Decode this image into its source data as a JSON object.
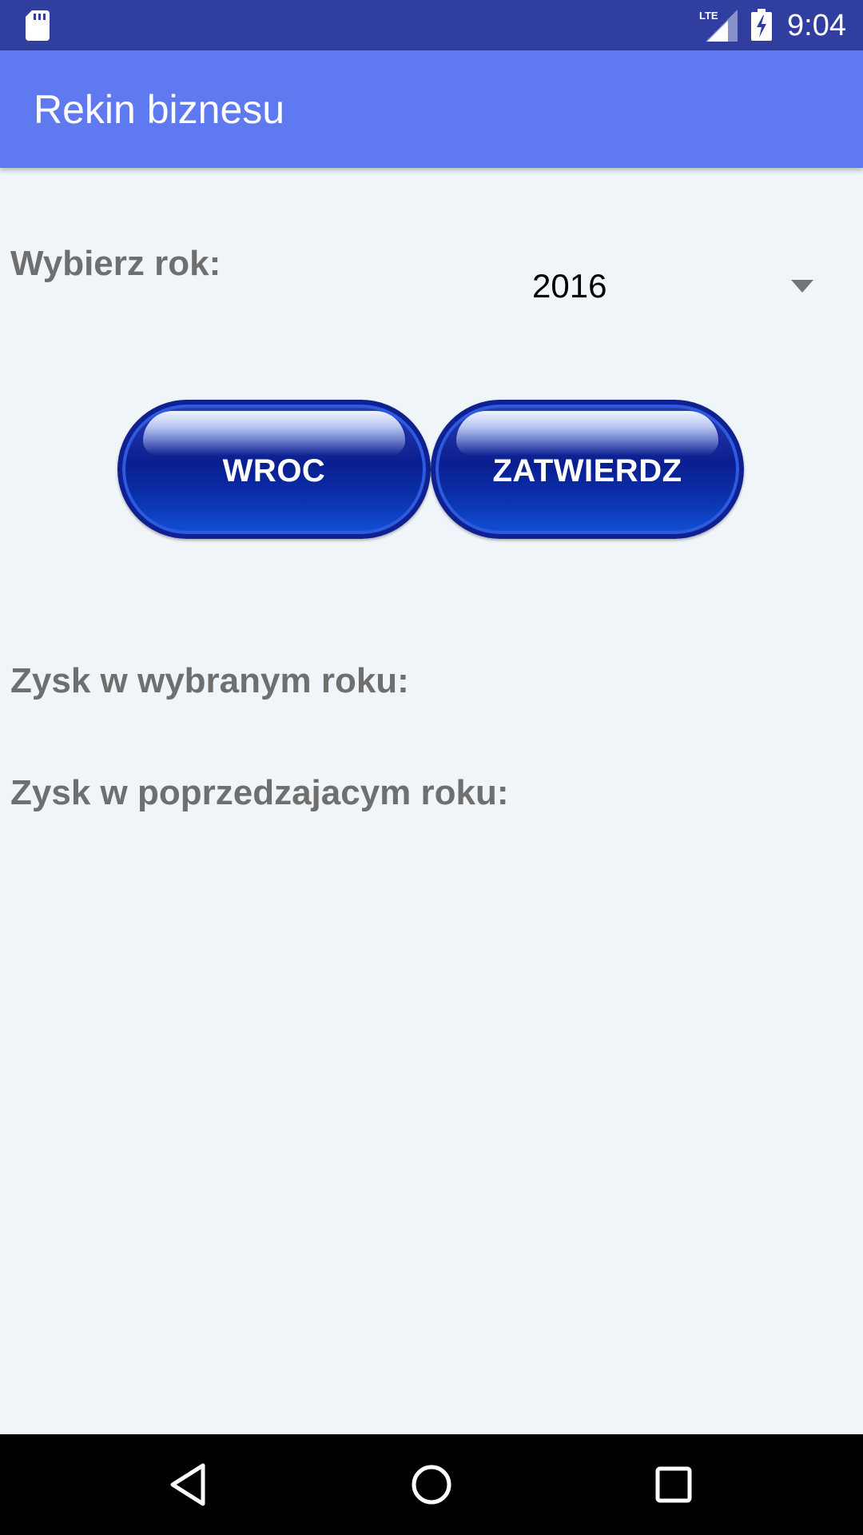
{
  "status_bar": {
    "time": "9:04",
    "network": "LTE",
    "icons": [
      "sd-card-icon",
      "lte-signal-icon",
      "battery-charging-icon"
    ]
  },
  "app_bar": {
    "title": "Rekin biznesu"
  },
  "year_selector": {
    "label": "Wybierz rok:",
    "selected_value": "2016"
  },
  "buttons": {
    "back_label": "WROC",
    "confirm_label": "ZATWIERDZ"
  },
  "results": {
    "selected_year_profit_label": "Zysk w wybranym roku:",
    "previous_year_profit_label": "Zysk w poprzedzajacym roku:"
  },
  "nav_bar": {
    "icons": [
      "back-icon",
      "home-icon",
      "recents-icon"
    ]
  },
  "colors": {
    "status_bar": "#303F9F",
    "app_bar": "#5F79F1",
    "background": "#F0F5F9",
    "label_text": "#6F6F6F",
    "button_blue": "#0A1E8F"
  }
}
